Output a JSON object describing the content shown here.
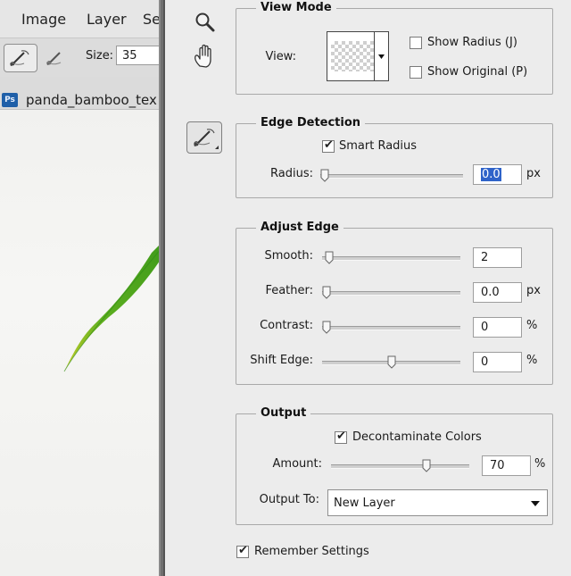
{
  "menu": {
    "items": [
      "Image",
      "Layer",
      "Se"
    ]
  },
  "options_bar": {
    "size_label": "Size:",
    "size_value": "35"
  },
  "document": {
    "badge": "Ps",
    "tab_title": "panda_bamboo_tex"
  },
  "view_mode": {
    "legend": "View Mode",
    "view_label": "View:",
    "show_radius": {
      "label": "Show Radius (J)",
      "checked": false
    },
    "show_original": {
      "label": "Show Original (P)",
      "checked": false
    }
  },
  "edge_detection": {
    "legend": "Edge Detection",
    "smart_radius": {
      "label": "Smart Radius",
      "checked": true
    },
    "radius": {
      "label": "Radius:",
      "value": "0.0",
      "unit": "px",
      "slider": 0.0
    }
  },
  "adjust_edge": {
    "legend": "Adjust Edge",
    "smooth": {
      "label": "Smooth:",
      "value": "2",
      "unit": "",
      "slider": 0.02
    },
    "feather": {
      "label": "Feather:",
      "value": "0.0",
      "unit": "px",
      "slider": 0.0
    },
    "contrast": {
      "label": "Contrast:",
      "value": "0",
      "unit": "%",
      "slider": 0.0
    },
    "shift": {
      "label": "Shift Edge:",
      "value": "0",
      "unit": "%",
      "slider": 0.5
    }
  },
  "output": {
    "legend": "Output",
    "decontaminate": {
      "label": "Decontaminate Colors",
      "checked": true
    },
    "amount": {
      "label": "Amount:",
      "value": "70",
      "unit": "%",
      "slider": 0.7
    },
    "output_to": {
      "label": "Output To:",
      "value": "New Layer"
    }
  },
  "remember": {
    "label": "Remember Settings",
    "checked": true
  },
  "icons": [
    "zoom-icon",
    "hand-icon",
    "refine-radius-brush-icon",
    "erase-refinements-icon"
  ]
}
